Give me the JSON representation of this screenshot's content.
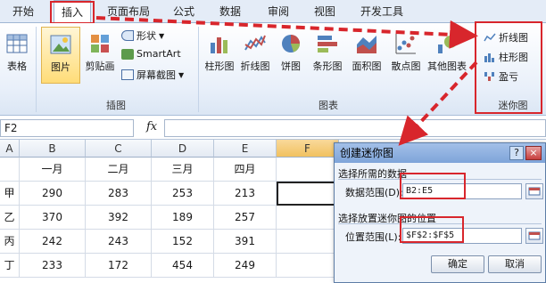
{
  "tabs": [
    "开始",
    "插入",
    "页面布局",
    "公式",
    "数据",
    "审阅",
    "视图",
    "开发工具"
  ],
  "ribbon": {
    "table_label": "表格",
    "picture_label": "图片",
    "clipart_label": "剪贴画",
    "shapes_label": "形状",
    "smartart_label": "SmartArt",
    "screenshot_label": "屏幕截图",
    "illustrations_group": "插图",
    "charts": [
      "柱形图",
      "折线图",
      "饼图",
      "条形图",
      "面积图",
      "散点图",
      "其他图表"
    ],
    "charts_group": "图表",
    "sparklines": [
      "折线图",
      "柱形图",
      "盈亏"
    ],
    "sparklines_group": "迷你图"
  },
  "formula_bar": {
    "name_box": "F2",
    "fx_label": "fx"
  },
  "grid": {
    "columns": [
      "A",
      "B",
      "C",
      "D",
      "E",
      "F"
    ],
    "header_row": [
      "",
      "一月",
      "二月",
      "三月",
      "四月",
      ""
    ],
    "rows": [
      [
        "甲",
        "290",
        "283",
        "253",
        "213"
      ],
      [
        "乙",
        "370",
        "392",
        "189",
        "257"
      ],
      [
        "丙",
        "242",
        "243",
        "152",
        "391"
      ],
      [
        "丁",
        "233",
        "172",
        "454",
        "249"
      ]
    ]
  },
  "dialog": {
    "title": "创建迷你图",
    "help": "?",
    "close": "×",
    "section1": "选择所需的数据",
    "data_range_label": "数据范围(D):",
    "data_range_value": "B2:E5",
    "section2": "选择放置迷你图的位置",
    "location_label": "位置范围(L):",
    "location_value": "$F$2:$F$5",
    "ok": "确定",
    "cancel": "取消"
  },
  "colors": {
    "highlight": "#d8262c",
    "ribbon_bg": "#e9f0fa",
    "tab_bg": "#e4ecf7"
  }
}
